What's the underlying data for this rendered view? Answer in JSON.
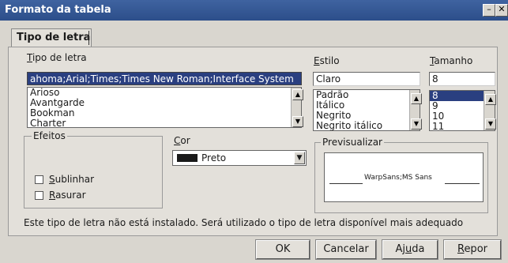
{
  "window": {
    "title": "Formato da tabela",
    "minimize_glyph": "–",
    "close_glyph": "✕"
  },
  "tab": {
    "label": "Tipo de letra"
  },
  "font": {
    "label_pre": "",
    "label_ul": "T",
    "label_post": "ipo de letra",
    "current_value": "ahoma;Arial;Times;Times New Roman;Interface System",
    "items": [
      "Arioso",
      "Avantgarde",
      "Bookman",
      "Charter"
    ]
  },
  "style": {
    "label_ul": "E",
    "label_post": "stilo",
    "current_value": "Claro",
    "items": [
      "Padrão",
      "Itálico",
      "Negrito",
      "Negrito itálico"
    ]
  },
  "size": {
    "label_ul": "T",
    "label_post": "amanho",
    "current_value": "8",
    "items": [
      "8",
      "9",
      "10",
      "11"
    ],
    "selected_index": 0
  },
  "effects": {
    "legend": "Efeitos",
    "underline": {
      "label_ul": "S",
      "label_post": "ublinhar",
      "checked": false
    },
    "strike": {
      "label_ul": "R",
      "label_post": "asurar",
      "checked": false
    }
  },
  "color": {
    "label_ul": "C",
    "label_post": "or",
    "value": "Preto",
    "swatch": "#1a1a1a"
  },
  "preview": {
    "legend": "Previsualizar",
    "text": "WarpSans;MS Sans"
  },
  "status_message": "Este tipo de letra não está instalado. Será utilizado o tipo de letra disponível mais adequado",
  "buttons": {
    "ok": "OK",
    "cancel": "Cancelar",
    "help_pre": "Aj",
    "help_ul": "u",
    "help_post": "da",
    "reset_ul": "R",
    "reset_post": "epor"
  },
  "icons": {
    "scroll_up": "▲",
    "scroll_down": "▼",
    "dropdown": "▼"
  }
}
